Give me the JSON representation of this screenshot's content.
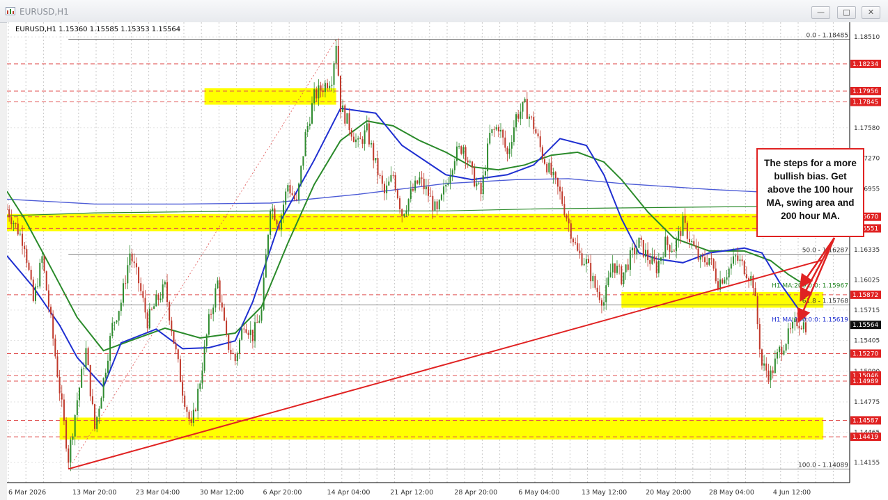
{
  "window": {
    "title": "EURUSD,H1",
    "buttons": [
      "minimize",
      "maximize",
      "close"
    ]
  },
  "chart_info": "EURUSD,H1  1.15360 1.15585 1.15353 1.15564",
  "annotation": "The steps for a more bullish bias. Get above the 100 hour MA, swing area and 200 hour MA.",
  "colors": {
    "background": "#ffffff",
    "bull_candle": "#2e8b2e",
    "bear_candle": "#c0392b",
    "ma100": "#1f2fd1",
    "ma200": "#2a8a2a",
    "long_ma": "#4c5bd6",
    "long_ma2": "#2a8a2a",
    "trendline": "#e02222",
    "zone": "#ffff00",
    "level_label_bg": "#e02222",
    "price_label_bg": "#111111"
  },
  "chart_data": {
    "type": "line",
    "symbol": "EURUSD",
    "timeframe": "H1",
    "ohlc": {
      "open": 1.1536,
      "high": 1.15585,
      "low": 1.15353,
      "close": 1.15564
    },
    "ylim": [
      1.1395,
      1.1866
    ],
    "x_ticks": [
      "6 Mar 2026",
      "13 Mar 20:00",
      "23 Mar 04:00",
      "30 Mar 12:00",
      "6 Apr 20:00",
      "14 Apr 04:00",
      "21 Apr 12:00",
      "28 Apr 20:00",
      "6 May 04:00",
      "13 May 12:00",
      "20 May 20:00",
      "28 May 04:00",
      "4 Jun 12:00"
    ],
    "y_ticks": [
      "1.18510",
      "1.17580",
      "1.17270",
      "1.16955",
      "1.16335",
      "1.16025",
      "1.15715",
      "1.15405",
      "1.15090",
      "1.14775",
      "1.14465",
      "1.14155"
    ],
    "y_tick_values": [
      1.1851,
      1.1758,
      1.1727,
      1.16955,
      1.16335,
      1.16025,
      1.15715,
      1.15405,
      1.1509,
      1.14775,
      1.14465,
      1.14155
    ],
    "level_labels": [
      {
        "text": "1.18234",
        "value": 1.18234
      },
      {
        "text": "1.17956",
        "value": 1.17956
      },
      {
        "text": "1.17845",
        "value": 1.17845
      },
      {
        "text": "1.16670",
        "value": 1.1667
      },
      {
        "text": "1.16551",
        "value": 1.16551
      },
      {
        "text": "1.15872",
        "value": 1.15872
      },
      {
        "text": "1.15270",
        "value": 1.1527
      },
      {
        "text": "1.15046",
        "value": 1.15046
      },
      {
        "text": "1.14989",
        "value": 1.14989
      },
      {
        "text": "1.14587",
        "value": 1.14587
      },
      {
        "text": "1.14419",
        "value": 1.14419
      }
    ],
    "current_price": "1.15564",
    "fib_levels": [
      {
        "text": "0.0 - 1.18485",
        "value": 1.18485
      },
      {
        "text": "50.0 - 1.16287",
        "value": 1.16287
      },
      {
        "text": "61.8 - 1.15768",
        "value": 1.15768
      },
      {
        "text": "100.0 - 1.14089",
        "value": 1.14089
      }
    ],
    "ma_labels": [
      {
        "text": "H1 MA:200:0:0: 1.15967",
        "value": 1.15967
      },
      {
        "text": "H1 MA:100:0:0: 1.15619",
        "value": 1.15619
      }
    ],
    "zones": [
      {
        "from_day": 22.5,
        "to_day": 37.5,
        "low": 1.17845,
        "high": 1.17956
      },
      {
        "from_day": 0,
        "to_day": 93,
        "low": 1.16551,
        "high": 1.1667
      },
      {
        "from_day": 70,
        "to_day": 93,
        "low": 1.15768,
        "high": 1.15872
      },
      {
        "from_day": 6,
        "to_day": 93,
        "low": 1.14419,
        "high": 1.14587
      }
    ],
    "trendline": {
      "start": [
        7,
        1.1409
      ],
      "end": [
        93,
        1.1623
      ]
    },
    "ma100_path": [
      [
        0,
        1.1627
      ],
      [
        3,
        1.1595
      ],
      [
        6,
        1.1556
      ],
      [
        8,
        1.1523
      ],
      [
        11,
        1.1493
      ],
      [
        13,
        1.1538
      ],
      [
        17,
        1.1552
      ],
      [
        20,
        1.1532
      ],
      [
        23,
        1.1533
      ],
      [
        26,
        1.154
      ],
      [
        28,
        1.158
      ],
      [
        31,
        1.166
      ],
      [
        35,
        1.1725
      ],
      [
        38,
        1.1778
      ],
      [
        42,
        1.1773
      ],
      [
        45,
        1.174
      ],
      [
        50,
        1.171
      ],
      [
        53,
        1.1705
      ],
      [
        57,
        1.171
      ],
      [
        60,
        1.172
      ],
      [
        63,
        1.1747
      ],
      [
        66,
        1.174
      ],
      [
        68,
        1.171
      ],
      [
        70,
        1.1665
      ],
      [
        72,
        1.163
      ],
      [
        74,
        1.1624
      ],
      [
        77,
        1.162
      ],
      [
        80,
        1.163
      ],
      [
        84,
        1.1635
      ],
      [
        86,
        1.163
      ],
      [
        88,
        1.16
      ],
      [
        91,
        1.15619
      ]
    ],
    "ma200_path": [
      [
        0,
        1.1693
      ],
      [
        2,
        1.1665
      ],
      [
        5,
        1.1615
      ],
      [
        8,
        1.1564
      ],
      [
        11,
        1.153
      ],
      [
        14,
        1.154
      ],
      [
        18,
        1.1553
      ],
      [
        22,
        1.1543
      ],
      [
        26,
        1.1548
      ],
      [
        29,
        1.1575
      ],
      [
        32,
        1.164
      ],
      [
        35,
        1.17
      ],
      [
        38,
        1.1745
      ],
      [
        41,
        1.1765
      ],
      [
        44,
        1.176
      ],
      [
        47,
        1.1745
      ],
      [
        50,
        1.1733
      ],
      [
        53,
        1.1718
      ],
      [
        56,
        1.1715
      ],
      [
        59,
        1.172
      ],
      [
        62,
        1.173
      ],
      [
        65,
        1.1733
      ],
      [
        68,
        1.1723
      ],
      [
        70,
        1.1705
      ],
      [
        73,
        1.1672
      ],
      [
        76,
        1.1645
      ],
      [
        80,
        1.1632
      ],
      [
        84,
        1.1632
      ],
      [
        87,
        1.1622
      ],
      [
        89,
        1.1608
      ],
      [
        91,
        1.15967
      ]
    ],
    "long_ma_path": [
      [
        0,
        1.1685
      ],
      [
        10,
        1.168
      ],
      [
        20,
        1.168
      ],
      [
        30,
        1.1681
      ],
      [
        40,
        1.169
      ],
      [
        50,
        1.1701
      ],
      [
        58,
        1.1705
      ],
      [
        64,
        1.1706
      ],
      [
        70,
        1.1701
      ],
      [
        80,
        1.1695
      ],
      [
        91,
        1.169
      ]
    ],
    "long_ma2_path": [
      [
        0,
        1.1668
      ],
      [
        10,
        1.1671
      ],
      [
        20,
        1.1672
      ],
      [
        30,
        1.1673
      ],
      [
        40,
        1.1673
      ],
      [
        50,
        1.1673
      ],
      [
        60,
        1.1675
      ],
      [
        70,
        1.1676
      ],
      [
        80,
        1.1677
      ],
      [
        91,
        1.1678
      ]
    ],
    "price_path": [
      [
        0,
        1.1675
      ],
      [
        2,
        1.164
      ],
      [
        3,
        1.158
      ],
      [
        4,
        1.1625
      ],
      [
        5,
        1.156
      ],
      [
        6,
        1.149
      ],
      [
        7,
        1.142
      ],
      [
        8,
        1.148
      ],
      [
        9,
        1.153
      ],
      [
        10,
        1.145
      ],
      [
        11,
        1.15
      ],
      [
        12,
        1.1555
      ],
      [
        13,
        1.158
      ],
      [
        14,
        1.163
      ],
      [
        15,
        1.16
      ],
      [
        16,
        1.156
      ],
      [
        17,
        1.158
      ],
      [
        18,
        1.1595
      ],
      [
        19,
        1.154
      ],
      [
        20,
        1.149
      ],
      [
        21,
        1.145
      ],
      [
        22,
        1.15
      ],
      [
        23,
        1.156
      ],
      [
        24,
        1.16
      ],
      [
        25,
        1.154
      ],
      [
        26,
        1.152
      ],
      [
        27,
        1.156
      ],
      [
        28,
        1.1545
      ],
      [
        29,
        1.157
      ],
      [
        30,
        1.168
      ],
      [
        31,
        1.166
      ],
      [
        32,
        1.17
      ],
      [
        33,
        1.168
      ],
      [
        34,
        1.175
      ],
      [
        35,
        1.179
      ],
      [
        36,
        1.18
      ],
      [
        37,
        1.181
      ],
      [
        37.5,
        1.1846
      ],
      [
        38,
        1.178
      ],
      [
        39,
        1.176
      ],
      [
        40,
        1.174
      ],
      [
        41,
        1.1755
      ],
      [
        42,
        1.172
      ],
      [
        43,
        1.169
      ],
      [
        44,
        1.171
      ],
      [
        45,
        1.167
      ],
      [
        46,
        1.169
      ],
      [
        47,
        1.1705
      ],
      [
        48,
        1.169
      ],
      [
        49,
        1.167
      ],
      [
        50,
        1.17
      ],
      [
        51,
        1.173
      ],
      [
        52,
        1.174
      ],
      [
        53,
        1.171
      ],
      [
        54,
        1.169
      ],
      [
        55,
        1.175
      ],
      [
        56,
        1.176
      ],
      [
        57,
        1.173
      ],
      [
        58,
        1.177
      ],
      [
        59,
        1.178
      ],
      [
        60,
        1.176
      ],
      [
        61,
        1.173
      ],
      [
        62,
        1.171
      ],
      [
        63,
        1.169
      ],
      [
        64,
        1.166
      ],
      [
        65,
        1.163
      ],
      [
        66,
        1.162
      ],
      [
        67,
        1.1595
      ],
      [
        68,
        1.158
      ],
      [
        69,
        1.162
      ],
      [
        70,
        1.1605
      ],
      [
        71,
        1.1625
      ],
      [
        72,
        1.164
      ],
      [
        73,
        1.1625
      ],
      [
        74,
        1.1615
      ],
      [
        75,
        1.164
      ],
      [
        76,
        1.1635
      ],
      [
        77,
        1.166
      ],
      [
        78,
        1.164
      ],
      [
        79,
        1.162
      ],
      [
        80,
        1.1625
      ],
      [
        81,
        1.16
      ],
      [
        82,
        1.161
      ],
      [
        83,
        1.1625
      ],
      [
        84,
        1.1615
      ],
      [
        85,
        1.16
      ],
      [
        86,
        1.1515
      ],
      [
        87,
        1.1505
      ],
      [
        88,
        1.153
      ],
      [
        89,
        1.1545
      ],
      [
        90,
        1.156
      ],
      [
        91,
        1.15564
      ]
    ]
  }
}
